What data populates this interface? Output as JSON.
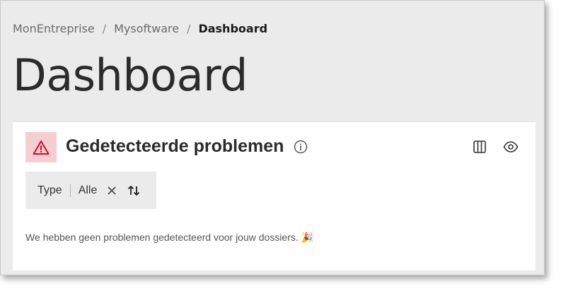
{
  "breadcrumb": {
    "items": [
      "MonEntreprise",
      "Mysoftware"
    ],
    "separator": "/",
    "current": "Dashboard"
  },
  "page_title": "Dashboard",
  "card": {
    "title": "Gedetecteerde problemen",
    "warning_icon": "warning-triangle-icon",
    "info_icon": "info-icon",
    "toolbar": {
      "columns_icon": "columns-icon",
      "visibility_icon": "eye-icon"
    },
    "filter": {
      "label": "Type",
      "value": "Alle",
      "clear_icon": "close-icon",
      "sort_icon": "sort-arrows-icon"
    },
    "empty_message": "We hebben geen problemen gedetecteerd voor jouw dossiers. 🎉"
  },
  "colors": {
    "page_background": "#ebebeb",
    "card_background": "#ffffff",
    "warning_background": "#f6cdd0",
    "warning_icon": "#c8102e",
    "text": "#2b2b2b"
  }
}
